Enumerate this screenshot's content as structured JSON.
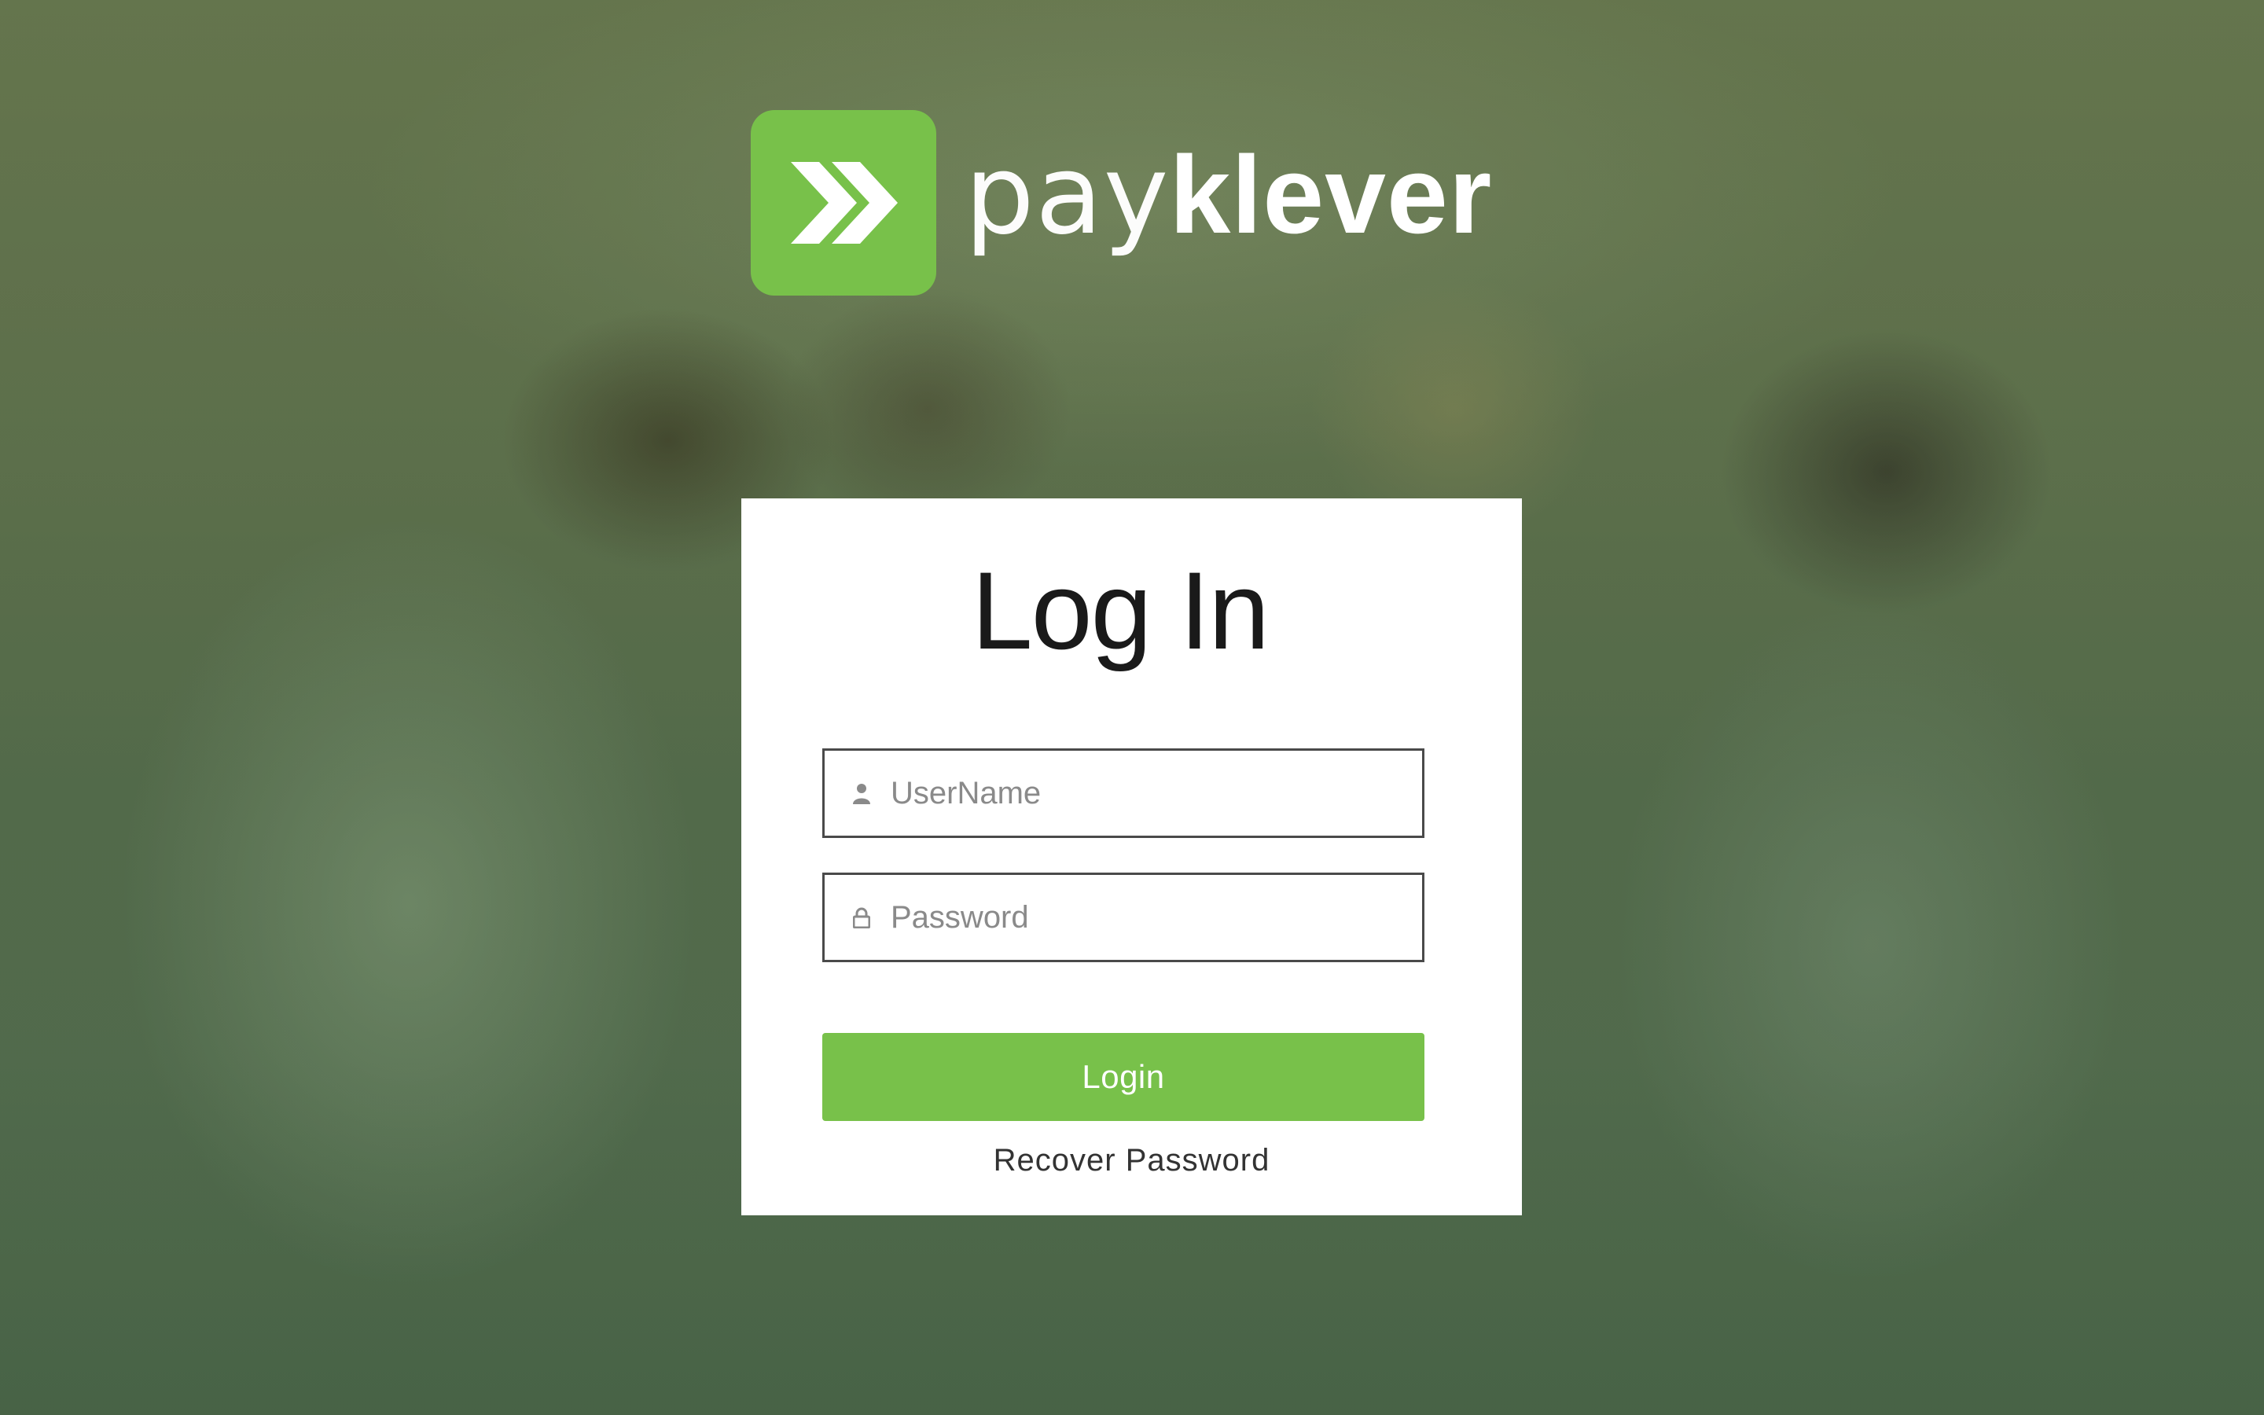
{
  "brand": {
    "name_light": "pay",
    "name_bold": "klever",
    "icon": "double-chevron-right-icon",
    "accent_color": "#78c14a"
  },
  "login_form": {
    "title": "Log In",
    "username": {
      "placeholder": "UserName",
      "value": "",
      "icon": "user-icon"
    },
    "password": {
      "placeholder": "Password",
      "value": "",
      "icon": "lock-icon"
    },
    "submit_label": "Login",
    "recover_label": "Recover Password"
  },
  "colors": {
    "accent": "#78c14a",
    "card_background": "#ffffff",
    "field_border": "#4a4a4a",
    "title_text": "#1a1a1a"
  }
}
